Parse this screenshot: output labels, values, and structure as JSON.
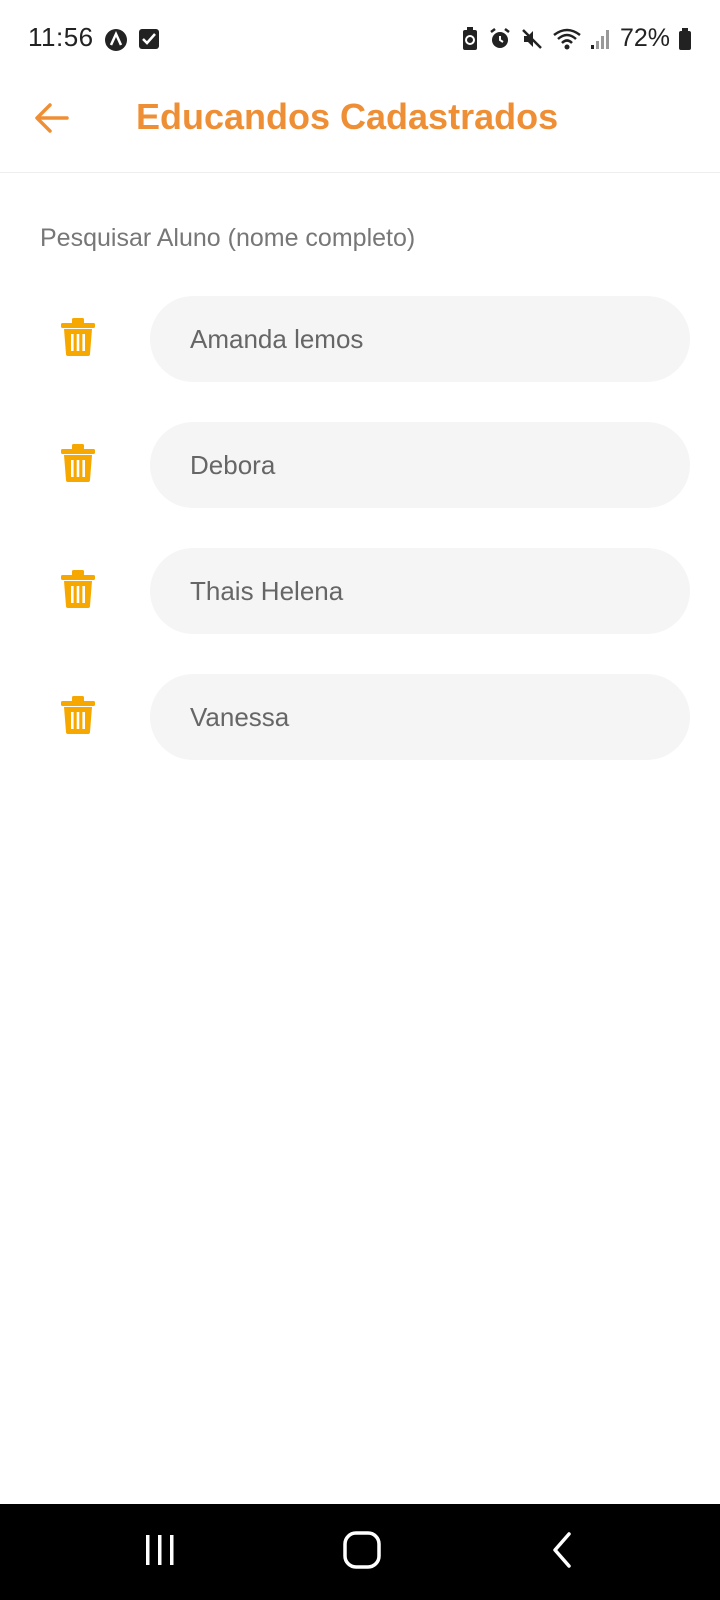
{
  "status_bar": {
    "time": "11:56",
    "battery_percent": "72%",
    "left_icons": [
      "app-notification-icon",
      "checkbox-notification-icon"
    ],
    "right_icons": [
      "battery-saver-icon",
      "alarm-icon",
      "mute-icon",
      "wifi-icon",
      "signal-icon",
      "battery-icon"
    ]
  },
  "header": {
    "title": "Educandos Cadastrados",
    "back_icon": "arrow-left-icon"
  },
  "search": {
    "label": "Pesquisar Aluno (nome completo)"
  },
  "students": [
    {
      "name": "Amanda lemos"
    },
    {
      "name": "Debora"
    },
    {
      "name": "Thais Helena"
    },
    {
      "name": "Vanessa"
    }
  ],
  "theme": {
    "accent": "#ef8f35",
    "icon_color": "#f6a800",
    "pill_bg": "#f5f5f5",
    "text_muted": "#666666"
  },
  "nav_bar": {
    "buttons": [
      "recent-apps-icon",
      "home-icon",
      "back-icon"
    ]
  }
}
